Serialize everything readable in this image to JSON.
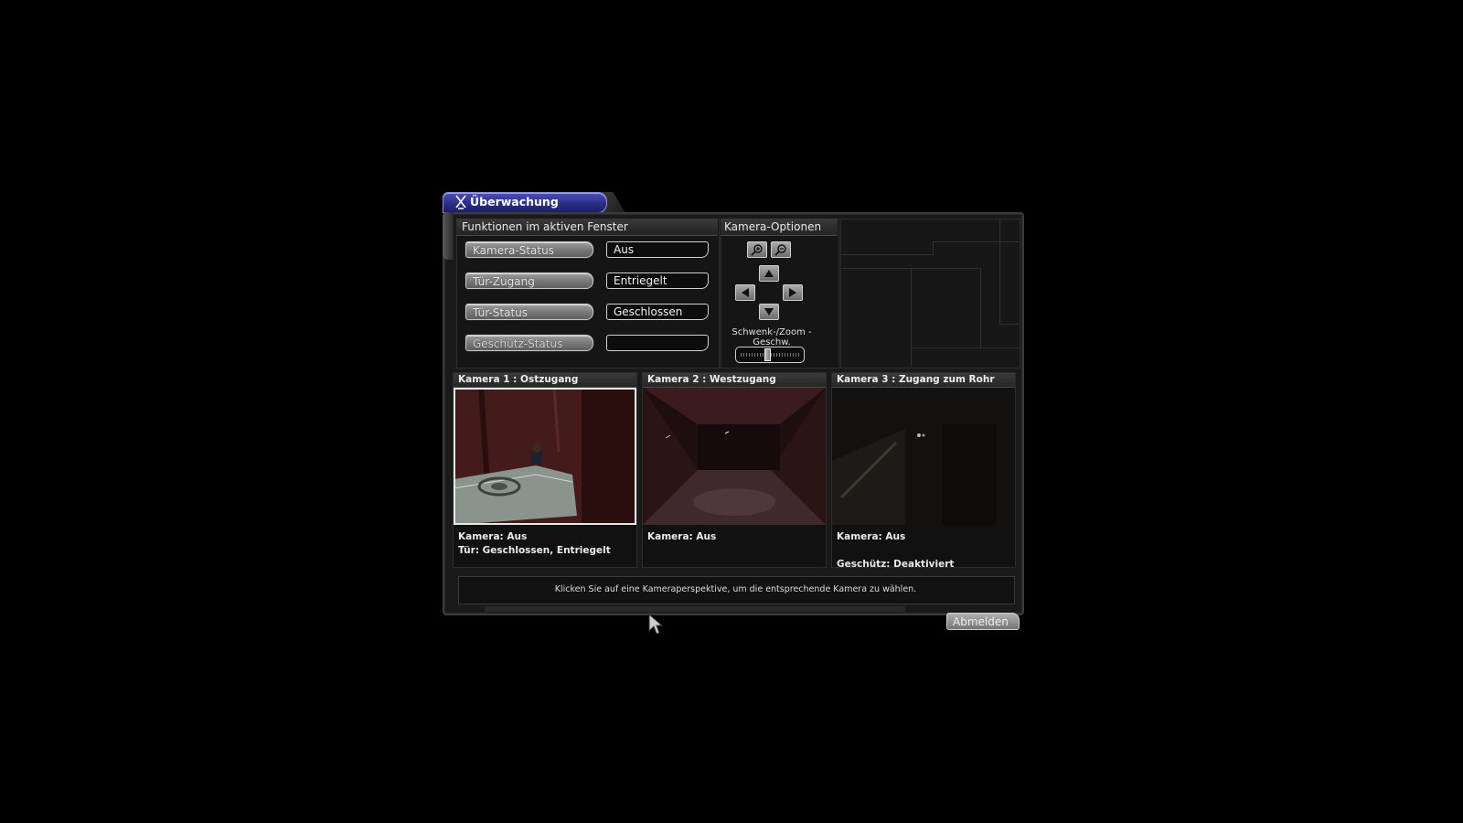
{
  "window": {
    "title": "Überwachung"
  },
  "functions_panel": {
    "title": "Funktionen im aktiven Fenster",
    "rows": [
      {
        "button": "Kamera-Status",
        "value": "Aus"
      },
      {
        "button": "Tür-Zugang",
        "value": "Entriegelt"
      },
      {
        "button": "Tür-Status",
        "value": "Geschlossen"
      },
      {
        "button": "Geschütz-Status",
        "value": ""
      }
    ]
  },
  "camera_options": {
    "title": "Kamera-Optionen",
    "zoom_in_icon": "zoom-in-icon",
    "zoom_out_icon": "zoom-out-icon",
    "pan_zoom_label": "Schwenk-/Zoom -Geschw.",
    "speed_level": 0.45
  },
  "cameras": [
    {
      "header": "Kamera 1 : Ostzugang",
      "selected": true,
      "info": [
        "Kamera: Aus",
        "Tür: Geschlossen, Entriegelt"
      ]
    },
    {
      "header": "Kamera 2 : Westzugang",
      "selected": false,
      "info": [
        "Kamera: Aus"
      ]
    },
    {
      "header": "Kamera 3 : Zugang zum Rohr",
      "selected": false,
      "info": [
        "Kamera: Aus",
        "",
        "Geschütz: Deaktiviert"
      ]
    }
  ],
  "status_bar": {
    "text": "Klicken Sie auf eine Kameraperspektive, um die entsprechende Kamera zu wählen."
  },
  "logout": {
    "label": "Abmelden"
  }
}
